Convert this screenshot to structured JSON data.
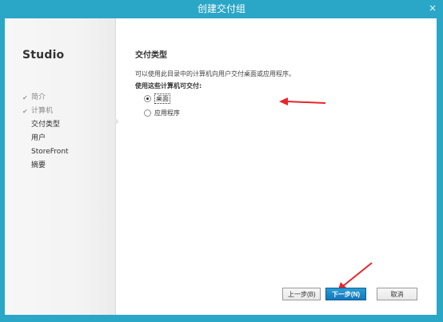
{
  "window": {
    "title": "创建交付组",
    "close_glyph": "×"
  },
  "sidebar": {
    "brand": "Studio",
    "items": [
      {
        "label": "简介",
        "check": "✔",
        "status": "done"
      },
      {
        "label": "计算机",
        "check": "✔",
        "status": "done"
      },
      {
        "label": "交付类型",
        "check": "",
        "status": "current"
      },
      {
        "label": "用户",
        "check": "",
        "status": "pending"
      },
      {
        "label": "StoreFront",
        "check": "",
        "status": "pending"
      },
      {
        "label": "摘要",
        "check": "",
        "status": "pending"
      }
    ]
  },
  "main": {
    "section_title": "交付类型",
    "description": "可以使用此目录中的计算机向用户交付桌面或应用程序。",
    "question": "使用这些计算机可交付:",
    "options": [
      {
        "label": "桌面",
        "selected": true
      },
      {
        "label": "应用程序",
        "selected": false
      }
    ]
  },
  "buttons": {
    "prev": "上一步(B)",
    "next": "下一步(N)",
    "cancel": "取消"
  },
  "colors": {
    "title_bar": "#2aa6c7",
    "annotation_arrow": "#e8252b",
    "primary_button": "#1a85c8"
  },
  "icons": {
    "check": "check-icon",
    "close": "close-icon",
    "annotation": "red-arrow-annotation"
  }
}
